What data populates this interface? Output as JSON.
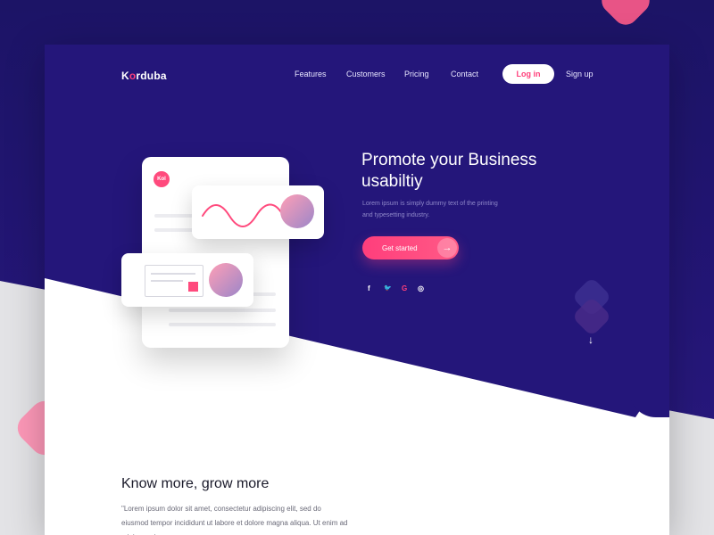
{
  "brand": {
    "logo_prefix": "K",
    "logo_dot": "o",
    "logo_suffix": "rduba"
  },
  "nav": {
    "links": [
      "Features",
      "Customers",
      "Pricing",
      "Contact"
    ],
    "login": "Log in",
    "signup": "Sign up"
  },
  "hero": {
    "title_line1": "Promote your Business",
    "title_line2": "usabiltiy",
    "subtitle": "Lorem ipsum is simply dummy text of the printing and typesetting industry.",
    "cta": "Get started",
    "cta_arrow": "→",
    "socials": [
      "f",
      "🐦",
      "G",
      "◎"
    ],
    "scroll_arrow": "↓"
  },
  "illustration": {
    "badge": "Kol"
  },
  "section": {
    "title": "Know more, grow more",
    "body": "\"Lorem ipsum dolor sit amet, consectetur adipiscing elit, sed do eiusmod tempor incididunt ut labore et dolore magna aliqua. Ut enim ad minim veniam"
  },
  "colors": {
    "hero_bg": "#24167a",
    "accent": "#ff3f7b",
    "text_light": "#e8e6ff"
  },
  "icons": [
    "facebook-icon",
    "twitter-icon",
    "google-icon",
    "instagram-icon",
    "arrow-right-icon",
    "arrow-down-icon"
  ]
}
